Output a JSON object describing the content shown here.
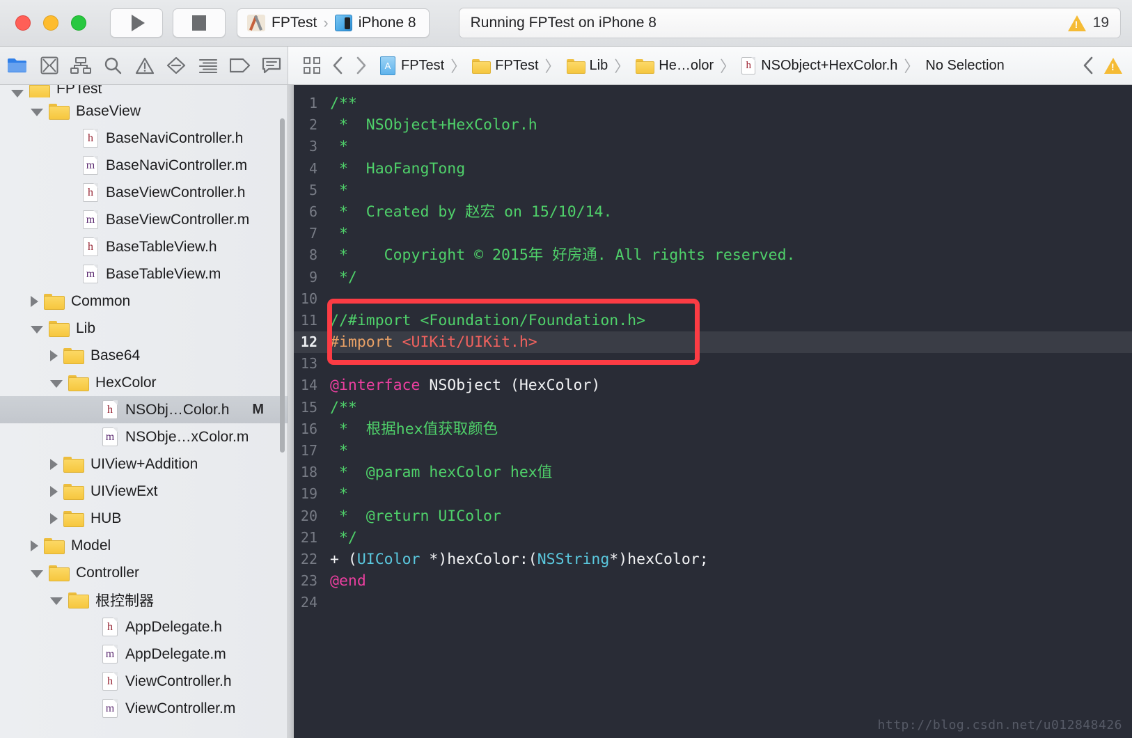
{
  "titlebar": {
    "window_controls": [
      "close",
      "minimize",
      "zoom"
    ],
    "run_button": "run-icon",
    "stop_button": "stop-icon",
    "scheme": {
      "project": "FPTest",
      "destination": "iPhone 8",
      "separator": "›"
    },
    "status": "Running FPTest on iPhone 8",
    "warning_count": "19"
  },
  "nav_toolbar": {
    "icons": [
      {
        "name": "project-navigator-icon",
        "active": true
      },
      {
        "name": "source-control-navigator-icon",
        "active": false
      },
      {
        "name": "symbol-navigator-icon",
        "active": false
      },
      {
        "name": "find-navigator-icon",
        "active": false
      },
      {
        "name": "issue-navigator-icon",
        "active": false
      },
      {
        "name": "test-navigator-icon",
        "active": false
      },
      {
        "name": "debug-navigator-icon",
        "active": false
      },
      {
        "name": "breakpoint-navigator-icon",
        "active": false
      },
      {
        "name": "report-navigator-icon",
        "active": false
      }
    ]
  },
  "editor_toolbar": {
    "related_items_icon": "related-items-icon",
    "back_icon": "chevron-left-icon",
    "forward_icon": "chevron-right-icon",
    "breadcrumb": [
      {
        "label": "FPTest",
        "icon": "xcode-project-icon"
      },
      {
        "label": "FPTest",
        "icon": "folder-icon"
      },
      {
        "label": "Lib",
        "icon": "folder-icon"
      },
      {
        "label": "He…olor",
        "icon": "folder-icon"
      },
      {
        "label": "NSObject+HexColor.h",
        "icon": "h-file-icon"
      },
      {
        "label": "No Selection",
        "icon": ""
      }
    ],
    "separator": "〉",
    "collapse_icon": "chevron-left-icon",
    "warning_icon": "warning-triangle-icon"
  },
  "sidebar": {
    "tree": [
      {
        "label": "FPTest",
        "indent": 1,
        "disc": "open",
        "icon": "folder",
        "clipped": true
      },
      {
        "label": "BaseView",
        "indent": 2,
        "disc": "open",
        "icon": "folder"
      },
      {
        "label": "BaseNaviController.h",
        "indent": 4,
        "disc": "none",
        "icon": "h"
      },
      {
        "label": "BaseNaviController.m",
        "indent": 4,
        "disc": "none",
        "icon": "m"
      },
      {
        "label": "BaseViewController.h",
        "indent": 4,
        "disc": "none",
        "icon": "h"
      },
      {
        "label": "BaseViewController.m",
        "indent": 4,
        "disc": "none",
        "icon": "m"
      },
      {
        "label": "BaseTableView.h",
        "indent": 4,
        "disc": "none",
        "icon": "h"
      },
      {
        "label": "BaseTableView.m",
        "indent": 4,
        "disc": "none",
        "icon": "m"
      },
      {
        "label": "Common",
        "indent": 2,
        "disc": "closed",
        "icon": "folder"
      },
      {
        "label": "Lib",
        "indent": 2,
        "disc": "open",
        "icon": "folder"
      },
      {
        "label": "Base64",
        "indent": 3,
        "disc": "closed",
        "icon": "folder"
      },
      {
        "label": "HexColor",
        "indent": 3,
        "disc": "open",
        "icon": "folder"
      },
      {
        "label": "NSObj…Color.h",
        "indent": 5,
        "disc": "none",
        "icon": "h",
        "badge": "M",
        "selected": true
      },
      {
        "label": "NSObje…xColor.m",
        "indent": 5,
        "disc": "none",
        "icon": "m"
      },
      {
        "label": "UIView+Addition",
        "indent": 3,
        "disc": "closed",
        "icon": "folder"
      },
      {
        "label": "UIViewExt",
        "indent": 3,
        "disc": "closed",
        "icon": "folder"
      },
      {
        "label": "HUB",
        "indent": 3,
        "disc": "closed",
        "icon": "folder"
      },
      {
        "label": "Model",
        "indent": 2,
        "disc": "closed",
        "icon": "folder"
      },
      {
        "label": "Controller",
        "indent": 2,
        "disc": "open",
        "icon": "folder"
      },
      {
        "label": "根控制器",
        "indent": 3,
        "disc": "open",
        "icon": "folder"
      },
      {
        "label": "AppDelegate.h",
        "indent": 5,
        "disc": "none",
        "icon": "h"
      },
      {
        "label": "AppDelegate.m",
        "indent": 5,
        "disc": "none",
        "icon": "m"
      },
      {
        "label": "ViewController.h",
        "indent": 5,
        "disc": "none",
        "icon": "h"
      },
      {
        "label": "ViewController.m",
        "indent": 5,
        "disc": "none",
        "icon": "m"
      }
    ]
  },
  "editor": {
    "current_line": 12,
    "highlight_box_color": "#fc3c44",
    "background_color": "#292c36",
    "watermark": "http://blog.csdn.net/u012848426",
    "lines": [
      {
        "n": 1,
        "tokens": [
          {
            "t": "/**",
            "c": "cmt"
          }
        ]
      },
      {
        "n": 2,
        "tokens": [
          {
            "t": " *  NSObject+HexColor.h",
            "c": "cmt"
          }
        ]
      },
      {
        "n": 3,
        "tokens": [
          {
            "t": " *",
            "c": "cmt"
          }
        ]
      },
      {
        "n": 4,
        "tokens": [
          {
            "t": " *  HaoFangTong",
            "c": "cmt"
          }
        ]
      },
      {
        "n": 5,
        "tokens": [
          {
            "t": " *",
            "c": "cmt"
          }
        ]
      },
      {
        "n": 6,
        "tokens": [
          {
            "t": " *  Created by 赵宏 on 15/10/14.",
            "c": "cmt"
          }
        ]
      },
      {
        "n": 7,
        "tokens": [
          {
            "t": " *",
            "c": "cmt"
          }
        ]
      },
      {
        "n": 8,
        "tokens": [
          {
            "t": " *    Copyright © 2015年 好房通. All rights reserved.",
            "c": "cmt"
          }
        ]
      },
      {
        "n": 9,
        "tokens": [
          {
            "t": " */",
            "c": "cmt"
          }
        ]
      },
      {
        "n": 10,
        "tokens": []
      },
      {
        "n": 11,
        "tokens": [
          {
            "t": "//#import <Foundation/Foundation.h>",
            "c": "cmt"
          }
        ]
      },
      {
        "n": 12,
        "tokens": [
          {
            "t": "#import ",
            "c": "pre"
          },
          {
            "t": "<UIKit/UIKit.h>",
            "c": "str"
          }
        ]
      },
      {
        "n": 13,
        "tokens": []
      },
      {
        "n": 14,
        "tokens": [
          {
            "t": "@interface ",
            "c": "kw"
          },
          {
            "t": "NSObject (HexColor)",
            "c": "pln"
          }
        ]
      },
      {
        "n": 15,
        "tokens": [
          {
            "t": "/**",
            "c": "cmt"
          }
        ]
      },
      {
        "n": 16,
        "tokens": [
          {
            "t": " *  根据hex值获取颜色",
            "c": "cmt"
          }
        ]
      },
      {
        "n": 17,
        "tokens": [
          {
            "t": " *",
            "c": "cmt"
          }
        ]
      },
      {
        "n": 18,
        "tokens": [
          {
            "t": " *  @param hexColor hex值",
            "c": "cmt"
          }
        ]
      },
      {
        "n": 19,
        "tokens": [
          {
            "t": " *",
            "c": "cmt"
          }
        ]
      },
      {
        "n": 20,
        "tokens": [
          {
            "t": " *  @return UIColor",
            "c": "cmt"
          }
        ]
      },
      {
        "n": 21,
        "tokens": [
          {
            "t": " */",
            "c": "cmt"
          }
        ]
      },
      {
        "n": 22,
        "tokens": [
          {
            "t": "+ (",
            "c": "pln"
          },
          {
            "t": "UIColor",
            "c": "typ"
          },
          {
            "t": " *)hexColor:(",
            "c": "pln"
          },
          {
            "t": "NSString",
            "c": "typ"
          },
          {
            "t": "*)hexColor;",
            "c": "pln"
          }
        ]
      },
      {
        "n": 23,
        "tokens": [
          {
            "t": "@end",
            "c": "kw"
          }
        ]
      },
      {
        "n": 24,
        "tokens": []
      }
    ]
  }
}
